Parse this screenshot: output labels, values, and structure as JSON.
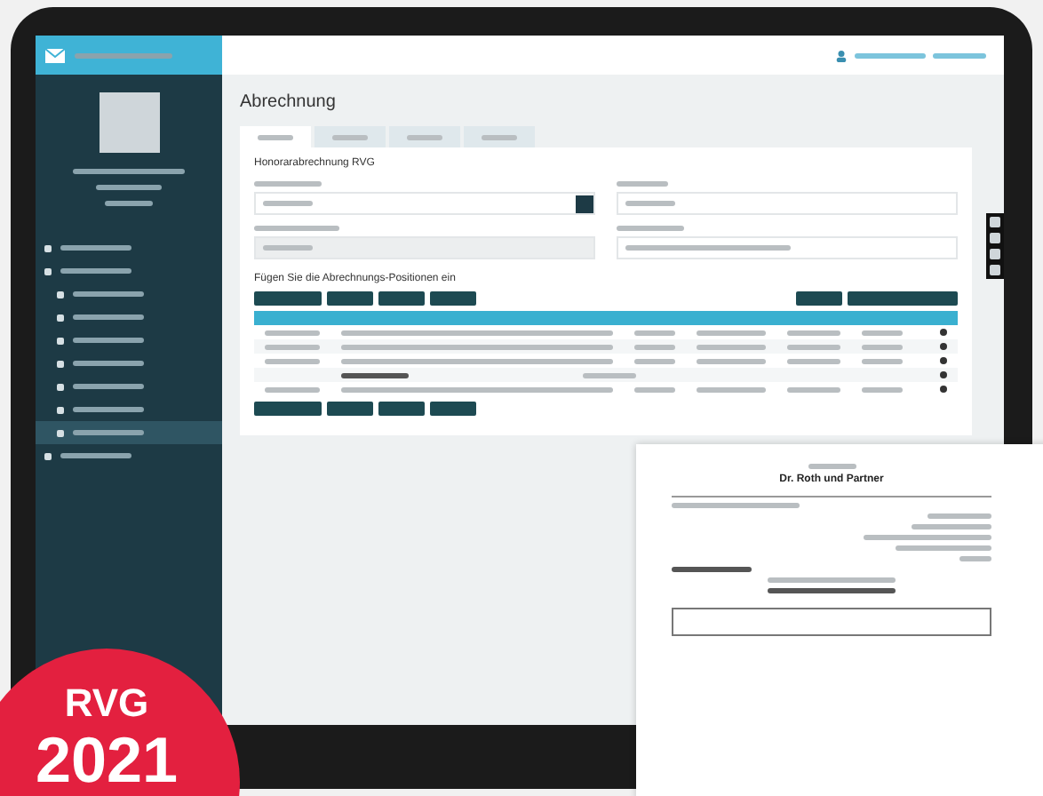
{
  "sidebar": {
    "menu": [
      {
        "selected": false
      },
      {
        "selected": false
      },
      {
        "selected": false
      },
      {
        "selected": false
      },
      {
        "selected": false
      },
      {
        "selected": false
      },
      {
        "selected": false
      },
      {
        "selected": false
      },
      {
        "selected": true
      },
      {
        "selected": false
      }
    ]
  },
  "page": {
    "title": "Abrechnung",
    "tabs": [
      {
        "selected": true
      },
      {
        "selected": false
      },
      {
        "selected": false
      },
      {
        "selected": false
      }
    ]
  },
  "form": {
    "title": "Honorarabrechnung RVG",
    "heading": "Fügen Sie die Abrechnungs-Positionen ein"
  },
  "table": {
    "rows": [
      {
        "kind": "position"
      },
      {
        "kind": "position"
      },
      {
        "kind": "position"
      },
      {
        "kind": "subtotal"
      },
      {
        "kind": "position"
      }
    ]
  },
  "document": {
    "firm": "Dr. Roth und Partner"
  },
  "badge": {
    "line_1": "RVG",
    "line_2": "2021"
  }
}
